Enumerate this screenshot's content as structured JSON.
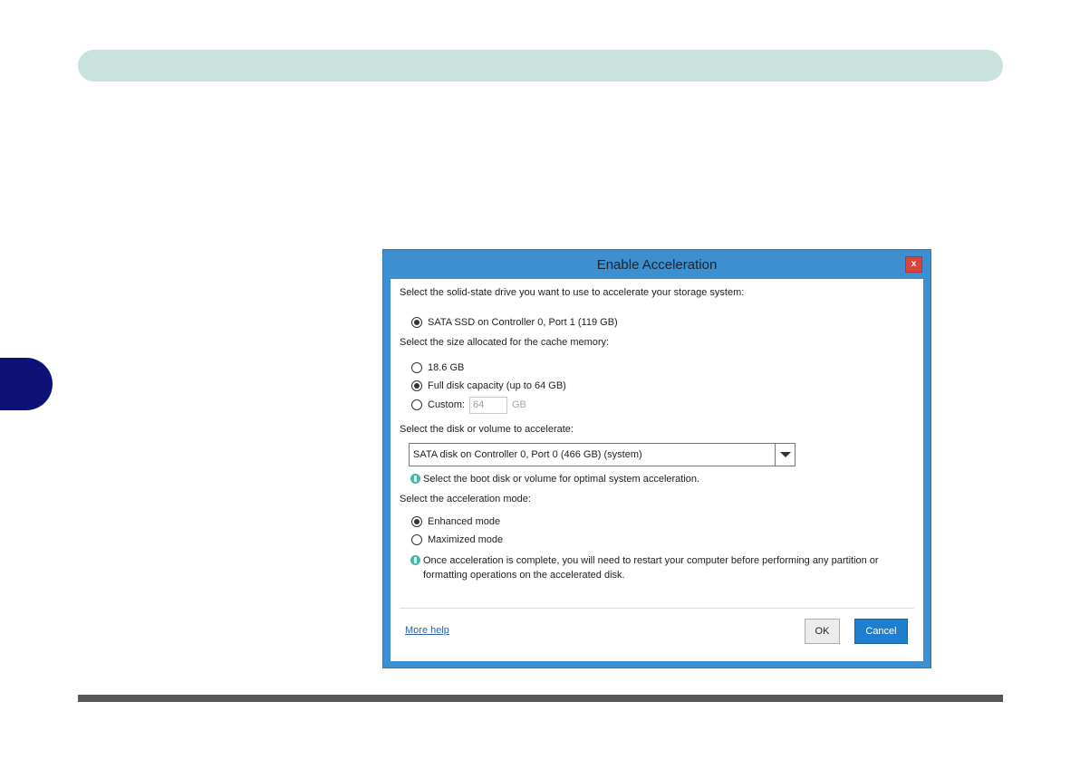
{
  "dialog": {
    "title": "Enable Acceleration",
    "close_label": "x",
    "ssd_section": {
      "label": "Select the solid-state drive you want to use to accelerate your storage system:",
      "options": [
        {
          "label": "SATA SSD on Controller 0, Port 1 (119 GB)",
          "checked": true
        }
      ]
    },
    "cache_section": {
      "label": "Select the size allocated for the cache memory:",
      "options": [
        {
          "label": "18.6 GB",
          "checked": false
        },
        {
          "label": "Full disk capacity (up to 64 GB)",
          "checked": true
        },
        {
          "label": "Custom:",
          "checked": false
        }
      ],
      "custom_value": "64",
      "custom_unit": "GB"
    },
    "disk_section": {
      "label": "Select the disk or volume to accelerate:",
      "selected": "SATA disk on Controller 0, Port 0 (466 GB) (system)",
      "tip": "Select the boot disk or volume for optimal system acceleration."
    },
    "mode_section": {
      "label": "Select the acceleration mode:",
      "options": [
        {
          "label": "Enhanced mode",
          "checked": true
        },
        {
          "label": "Maximized mode",
          "checked": false
        }
      ],
      "tip_line1": "Once acceleration is complete, you will need to restart your computer before performing any partition or",
      "tip_line2": "formatting operations on the accelerated disk."
    },
    "more_help": "More help",
    "ok_label": "OK",
    "cancel_label": "Cancel"
  },
  "colors": {
    "banner": "#c9e2dd",
    "side_tab": "#0d1176",
    "dialog_frame": "#3d8fd0",
    "close_button": "#d6463f",
    "primary_button": "#1e7fd0",
    "info_icon": "#46b6a6"
  }
}
